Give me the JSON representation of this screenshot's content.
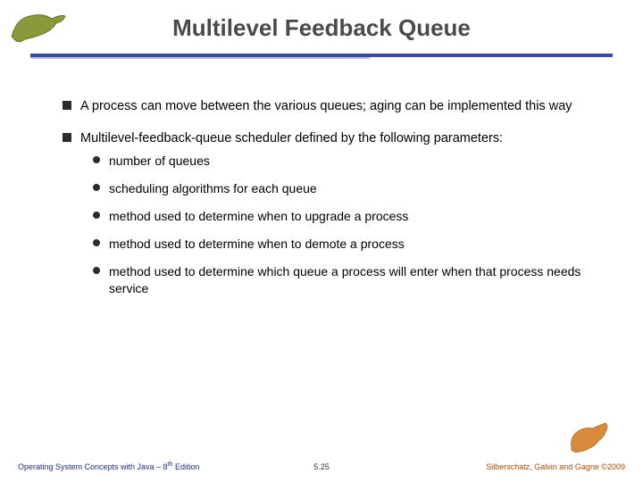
{
  "title": "Multilevel Feedback Queue",
  "bullets": [
    {
      "text": "A process can move between the various queues; aging can be implemented this way"
    },
    {
      "text": "Multilevel-feedback-queue scheduler defined by the following parameters:",
      "sub": [
        "number of queues",
        "scheduling algorithms for each queue",
        "method used to determine when to upgrade a process",
        "method used to determine when to demote a process",
        "method used to determine which queue a process will enter when that process needs service"
      ]
    }
  ],
  "footer": {
    "left_pre": "Operating System Concepts with Java – 8",
    "left_sup": "th",
    "left_post": " Edition",
    "center": "5.25",
    "right": "Silberschatz, Galvin and Gagne ©2009"
  },
  "logos": {
    "top_left": "dinosaur-icon",
    "bottom_right": "dinosaur-icon"
  }
}
